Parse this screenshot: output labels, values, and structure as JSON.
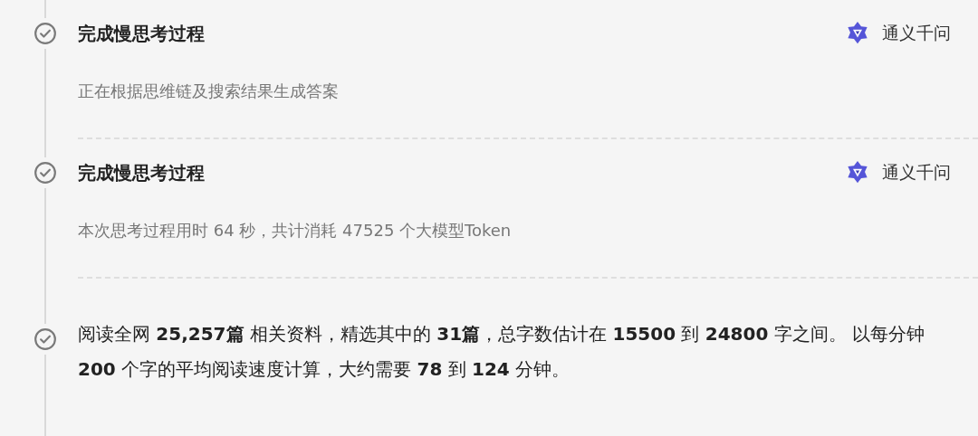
{
  "steps": [
    {
      "kind": "status",
      "title": "完成慢思考过程",
      "source": "通义千问",
      "description": "正在根据思维链及搜索结果生成答案"
    },
    {
      "kind": "status",
      "title": "完成慢思考过程",
      "source": "通义千问",
      "description": "本次思考过程用时 64 秒，共计消耗 47525 个大模型Token"
    },
    {
      "kind": "summary",
      "text": "阅读全网 **25,257篇** 相关资料，精选其中的 **31篇**，总字数估计在 **15500** 到 **24800** 字之间。 以每分钟 **200** 个字的平均阅读速度计算，大约需要 **78** 到 **124** 分钟。"
    }
  ]
}
